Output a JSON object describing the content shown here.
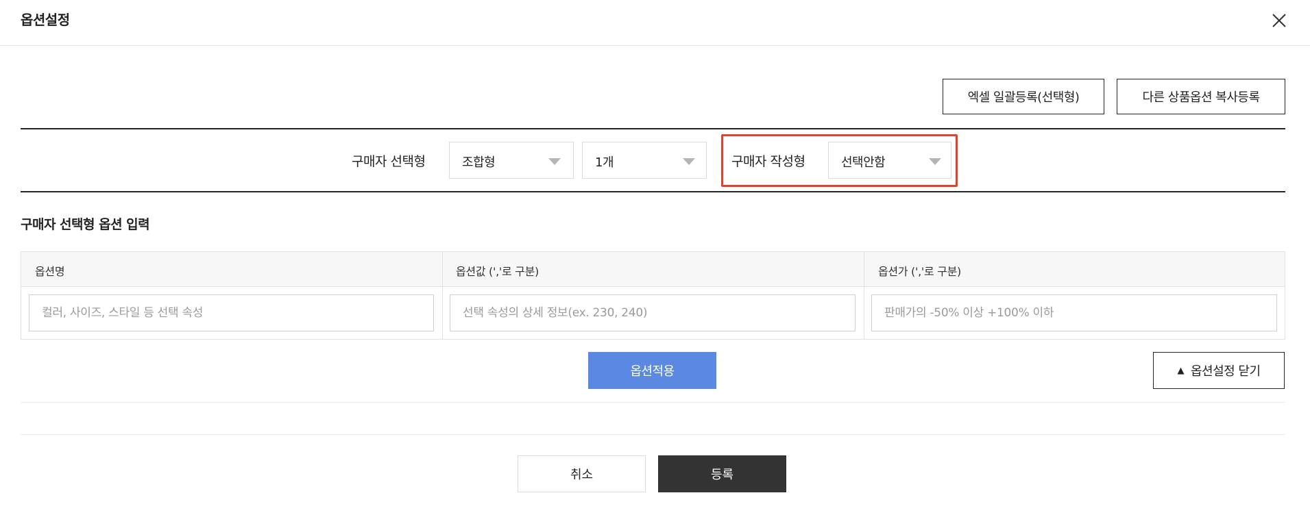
{
  "header": {
    "title": "옵션설정",
    "close_icon": "close-icon"
  },
  "toolbar": {
    "excel_button": "엑셀 일괄등록(선택형)",
    "copy_button": "다른 상품옵션 복사등록"
  },
  "option_type": {
    "buyer_select_label": "구매자 선택형",
    "combination_select": "조합형",
    "count_select": "1개",
    "buyer_write_label": "구매자 작성형",
    "buyer_write_select": "선택안함",
    "highlight_color": "#d9452f"
  },
  "section": {
    "title": "구매자 선택형 옵션 입력"
  },
  "option_table": {
    "columns": [
      "옵션명",
      "옵션값 (','로 구분)",
      "옵션가 (','로 구분)"
    ],
    "placeholders": [
      "컬러, 사이즈, 스타일 등 선택 속성",
      "선택 속성의 상세 정보(ex. 230, 240)",
      "판매가의 -50% 이상 +100% 이하"
    ]
  },
  "actions": {
    "apply_button": "옵션적용",
    "close_options_button": "옵션설정 닫기",
    "close_options_icon": "triangle-up-icon",
    "apply_color": "#5b88e0"
  },
  "footer": {
    "cancel_button": "취소",
    "register_button": "등록"
  }
}
